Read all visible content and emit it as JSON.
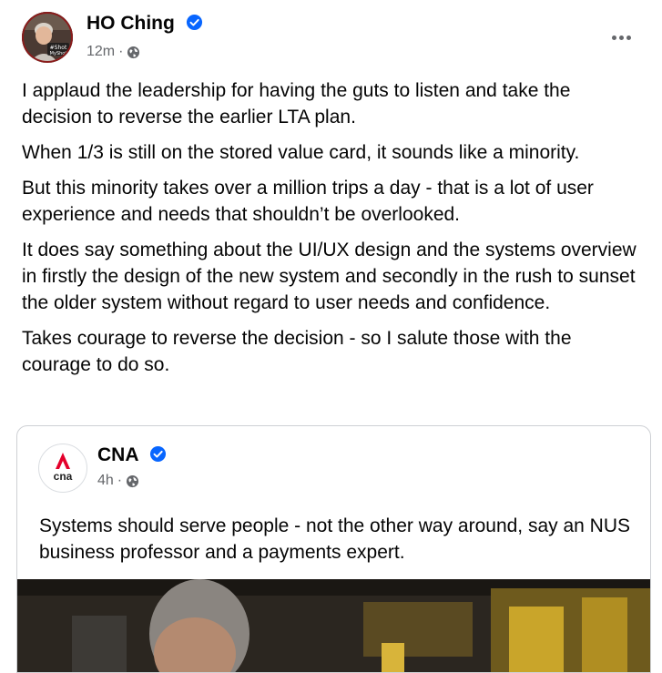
{
  "post": {
    "author": "HO Ching",
    "time": "12m",
    "separator": "·",
    "audience_icon": "globe-icon",
    "paragraphs": [
      "I applaud the leadership for having the guts to listen and take the decision to reverse the earlier LTA plan.",
      "When 1/3 is still on the stored value card, it sounds like a minority.",
      "But this minority takes over a million trips a day - that is a lot of user experience and needs that shouldn’t be overlooked.",
      "It does say something about the UI/UX design and the systems overview in firstly the design of the new system and secondly in the rush to sunset the older system without regard to user needs and confidence.",
      "Takes courage to reverse the decision - so I salute those with the courage to do so."
    ]
  },
  "shared_post": {
    "page_name": "CNA",
    "logo_text": "cna",
    "time": "4h",
    "separator": "·",
    "audience_icon": "globe-icon",
    "text": "Systems should serve people - not the other way around, say an NUS business professor and a payments expert."
  },
  "colors": {
    "verified_blue": "#0866ff",
    "secondary_text": "#65676b",
    "cna_red": "#e4002b"
  }
}
